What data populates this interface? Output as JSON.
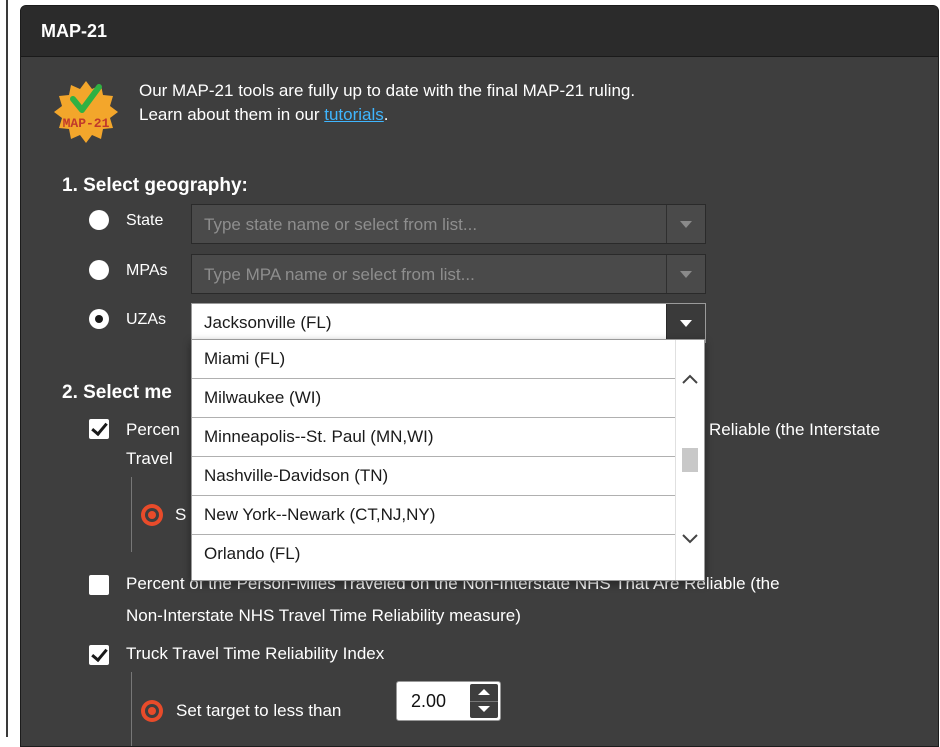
{
  "panel": {
    "title": "MAP-21"
  },
  "badge": {
    "text": "MAP-21"
  },
  "intro": {
    "line1": "Our MAP-21 tools are fully up to date with the final MAP-21 ruling.",
    "line2_prefix": "Learn about them in our ",
    "link": "tutorials",
    "line2_suffix": "."
  },
  "geography": {
    "title": "1. Select geography:",
    "options": [
      {
        "label": "State",
        "placeholder": "Type state name or select from list...",
        "selected": false
      },
      {
        "label": "MPAs",
        "placeholder": "Type MPA name or select from list...",
        "selected": false
      },
      {
        "label": "UZAs",
        "value": "Jacksonville (FL)",
        "selected": true
      }
    ],
    "dropdown_items": [
      "Miami (FL)",
      "Milwaukee (WI)",
      "Minneapolis--St. Paul (MN,WI)",
      "Nashville-Davidson (TN)",
      "New York--Newark (CT,NJ,NY)",
      "Orlando (FL)"
    ]
  },
  "measures": {
    "title_visible": "2. Select me",
    "item1_left_line1": "Percen",
    "item1_left_line2": "Travel",
    "item1_right": "Reliable (the Interstate",
    "item1_target_fragment": "S",
    "item2_line1": "Percent of the Person-Miles Traveled on the Non-Interstate NHS That Are Reliable (the",
    "item2_line2": "Non-Interstate NHS Travel Time Reliability measure)",
    "item3_label": "Truck Travel Time Reliability Index",
    "item3_target_label": "Set target to less than",
    "item3_target_value": "2.00"
  }
}
